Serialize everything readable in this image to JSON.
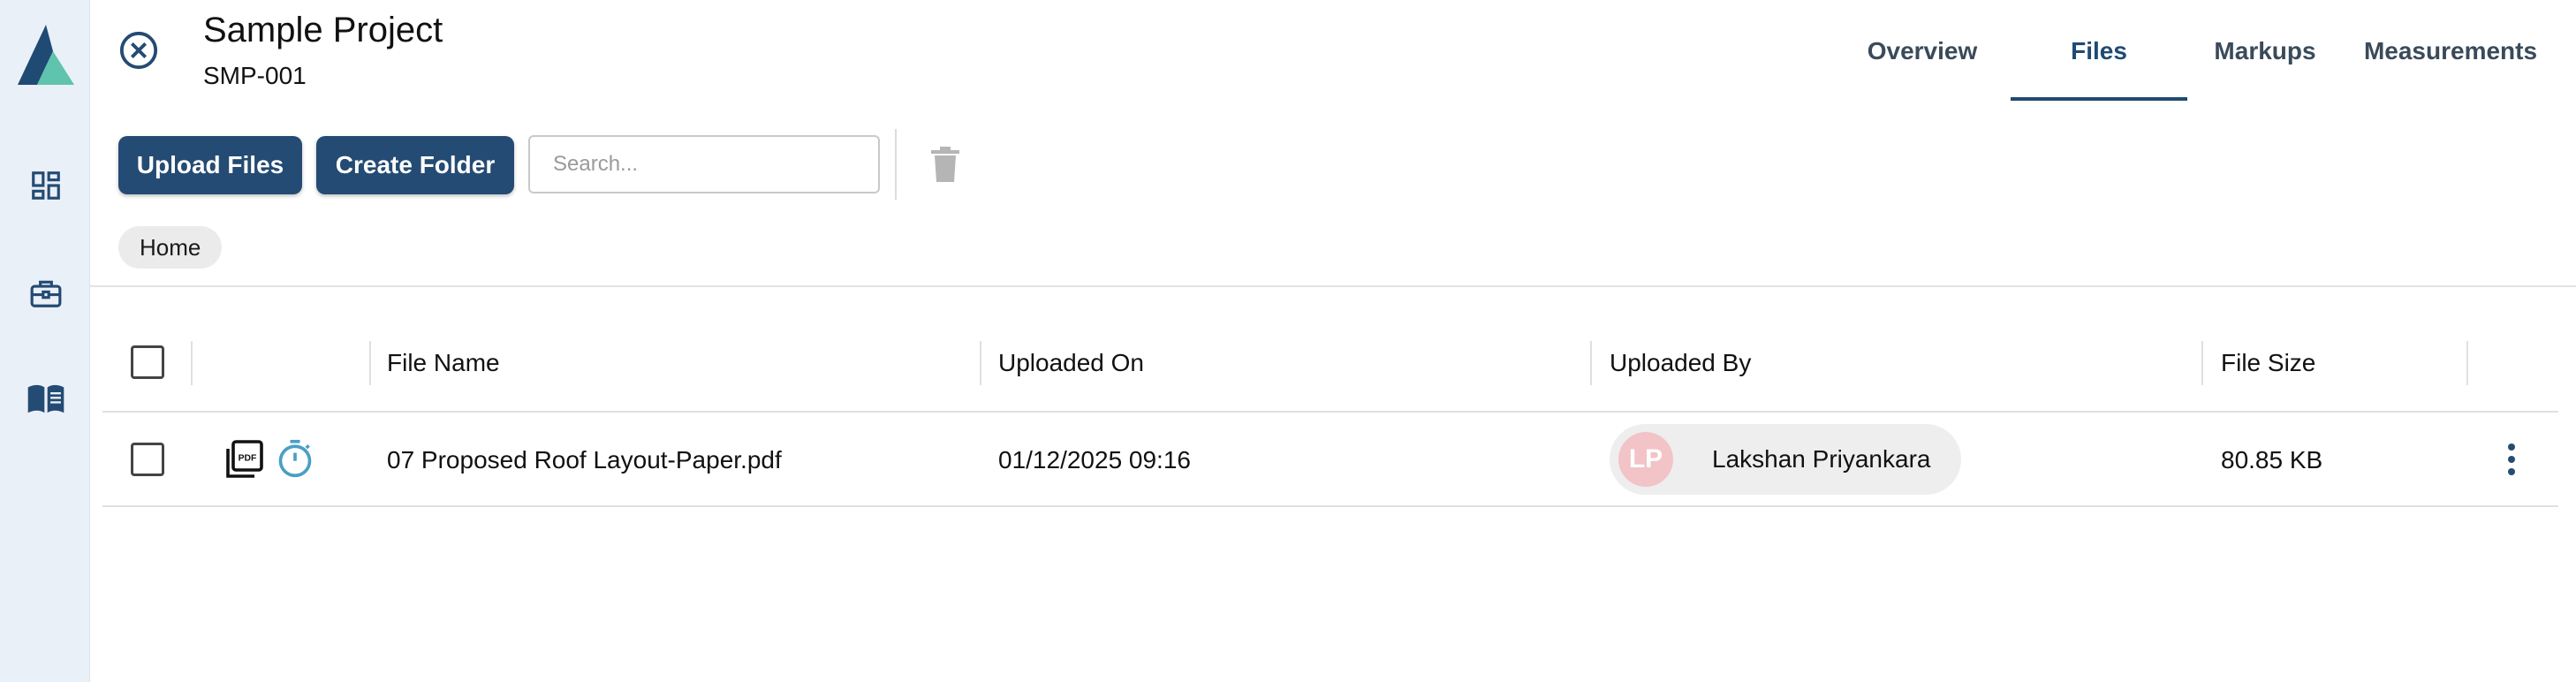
{
  "project": {
    "title": "Sample Project",
    "code": "SMP-001"
  },
  "tabs": [
    {
      "label": "Overview",
      "active": false
    },
    {
      "label": "Files",
      "active": true
    },
    {
      "label": "Markups",
      "active": false
    },
    {
      "label": "Measurements",
      "active": false
    }
  ],
  "sidebar": {
    "logo": "company-logo",
    "items": [
      {
        "icon": "dashboard-icon"
      },
      {
        "icon": "briefcase-icon"
      },
      {
        "icon": "book-icon"
      }
    ]
  },
  "toolbar": {
    "upload_label": "Upload Files",
    "create_folder_label": "Create Folder",
    "search_placeholder": "Search...",
    "delete_icon": "trash-icon"
  },
  "breadcrumb": {
    "home": "Home"
  },
  "table": {
    "columns": [
      "File Name",
      "Uploaded On",
      "Uploaded By",
      "File Size"
    ],
    "rows": [
      {
        "file_name": "07 Proposed Roof Layout-Paper.pdf",
        "uploaded_on": "01/12/2025 09:16",
        "uploader_initials": "LP",
        "uploaded_by": "Lakshan Priyankara",
        "file_size": "80.85 KB",
        "icons": [
          "pdf-icon",
          "timer-icon"
        ]
      }
    ]
  },
  "colors": {
    "primary": "#244b73",
    "tab_active": "#1f4a73",
    "sidebar_bg": "#eaf0f7",
    "timer_icon": "#4a9fc3",
    "avatar_bg": "#f2c3c7",
    "logo_dark": "#1f4a73",
    "logo_light": "#5fc3ad"
  }
}
